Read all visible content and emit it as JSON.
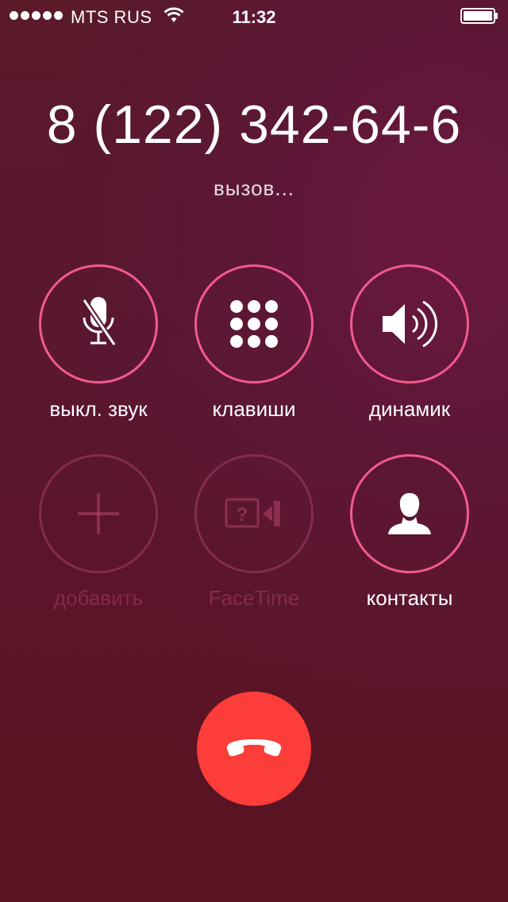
{
  "status_bar": {
    "signal_dots": 5,
    "carrier": "MTS RUS",
    "wifi_icon": "wifi-icon",
    "time": "11:32",
    "battery_icon": "battery-icon"
  },
  "call": {
    "number": "8 (122) 342-64-6",
    "status": "вызов..."
  },
  "controls": {
    "mute_label": "выкл. звук",
    "keypad_label": "клавиши",
    "speaker_label": "динамик",
    "add_label": "добавить",
    "facetime_label": "FaceTime",
    "contacts_label": "контакты"
  },
  "colors": {
    "ring": "#f25a8f",
    "ring_disabled": "#b4466e",
    "end_call": "#fc3d39"
  }
}
